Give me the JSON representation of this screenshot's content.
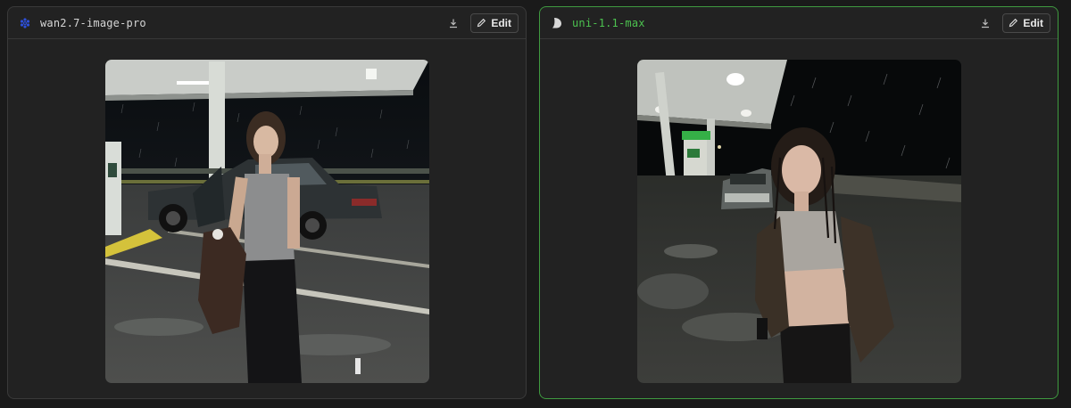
{
  "panels": [
    {
      "model_name": "wan2.7-image-pro",
      "model_icon": "blue-flower-icon",
      "selected": false,
      "edit_label": "Edit"
    },
    {
      "model_name": "uni-1.1-max",
      "model_icon": "crescent-logo-icon",
      "selected": true,
      "edit_label": "Edit"
    }
  ],
  "colors": {
    "background": "#1a1a1a",
    "panel_bg": "#222222",
    "selected_border": "#3f9a40",
    "selected_text": "#4cc24f",
    "wan_icon": "#2d4fd8"
  }
}
